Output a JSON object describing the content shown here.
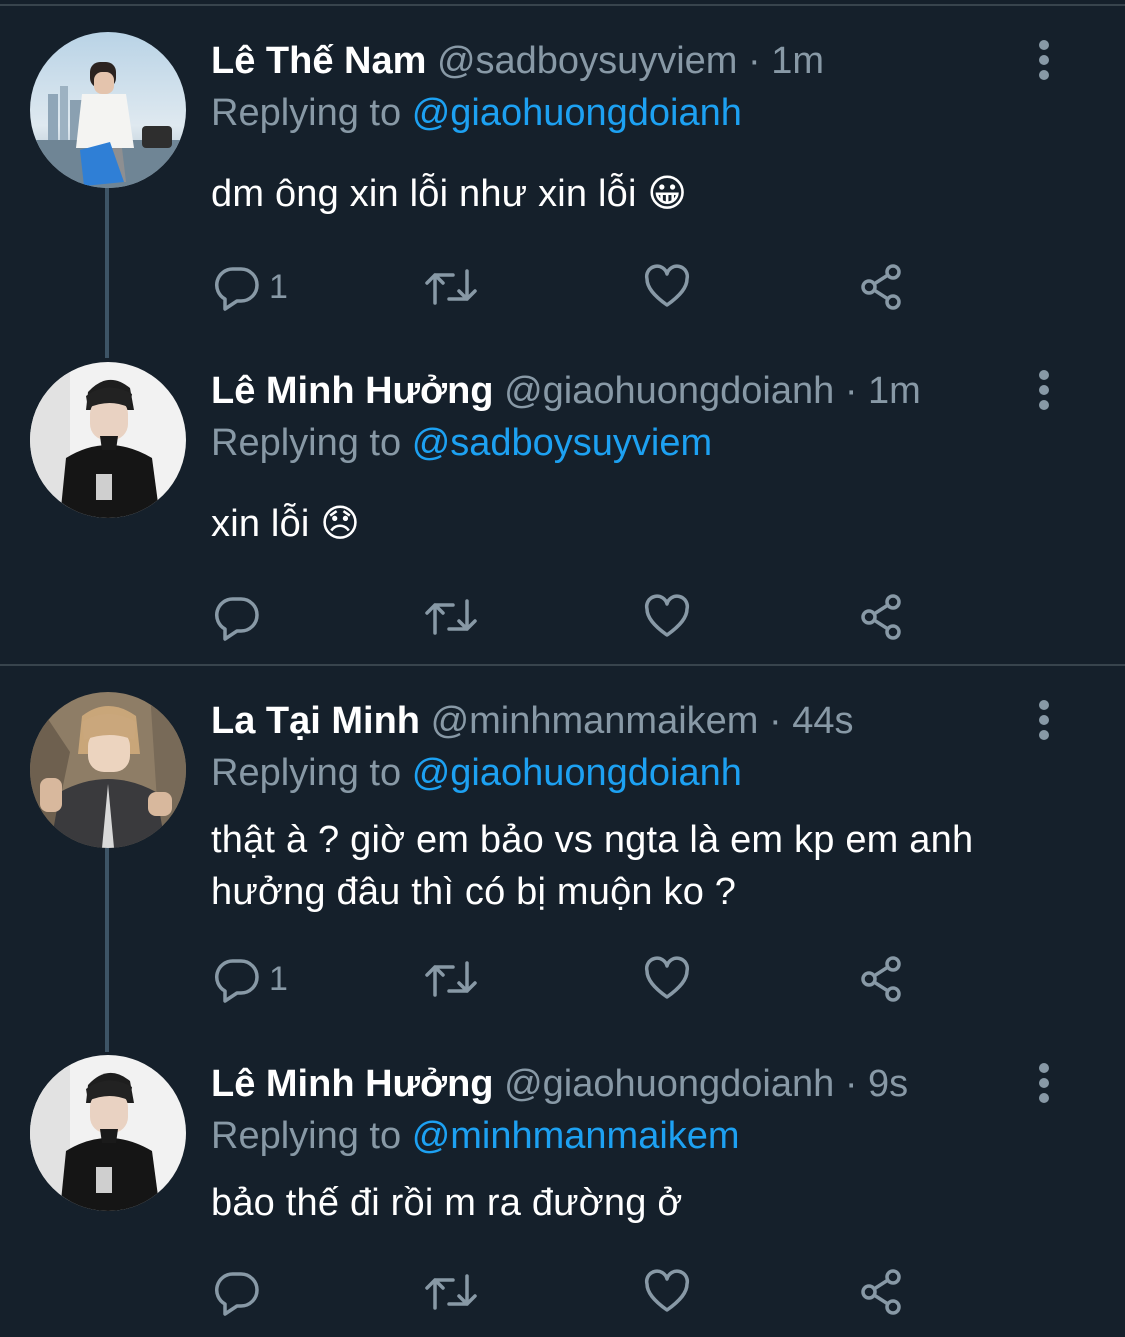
{
  "tweets": [
    {
      "name": "Lê Thế Nam",
      "handle": "@sadboysuyviem",
      "time": "1m",
      "replying_prefix": "Replying to",
      "replying_to": "@giaohuongdoianh",
      "text": "dm ông xin lỗi như xin lỗi 😀",
      "reply_count": "1"
    },
    {
      "name": "Lê Minh Hưởng",
      "handle": "@giaohuongdoianh",
      "time": "1m",
      "replying_prefix": "Replying to",
      "replying_to": "@sadboysuyviem",
      "text": "xin lỗi 😞",
      "reply_count": ""
    },
    {
      "name": "La Tại Minh",
      "handle": "@minhmanmaikem",
      "time": "44s",
      "replying_prefix": "Replying to",
      "replying_to": "@giaohuongdoianh",
      "text": "thật à ? giờ em bảo vs ngta là em kp em anh hưởng đâu thì có bị muộn ko ?",
      "reply_count": "1"
    },
    {
      "name": "Lê Minh Hưởng",
      "handle": "@giaohuongdoianh",
      "time": "9s",
      "replying_prefix": "Replying to",
      "replying_to": "@minhmanmaikem",
      "text": "bảo thế đi rồi m ra đường ở",
      "reply_count": ""
    }
  ],
  "separator": "·",
  "colors": {
    "background": "#15202b",
    "secondary_text": "#8899a6",
    "link": "#1da1f2",
    "divider": "#38444d"
  }
}
